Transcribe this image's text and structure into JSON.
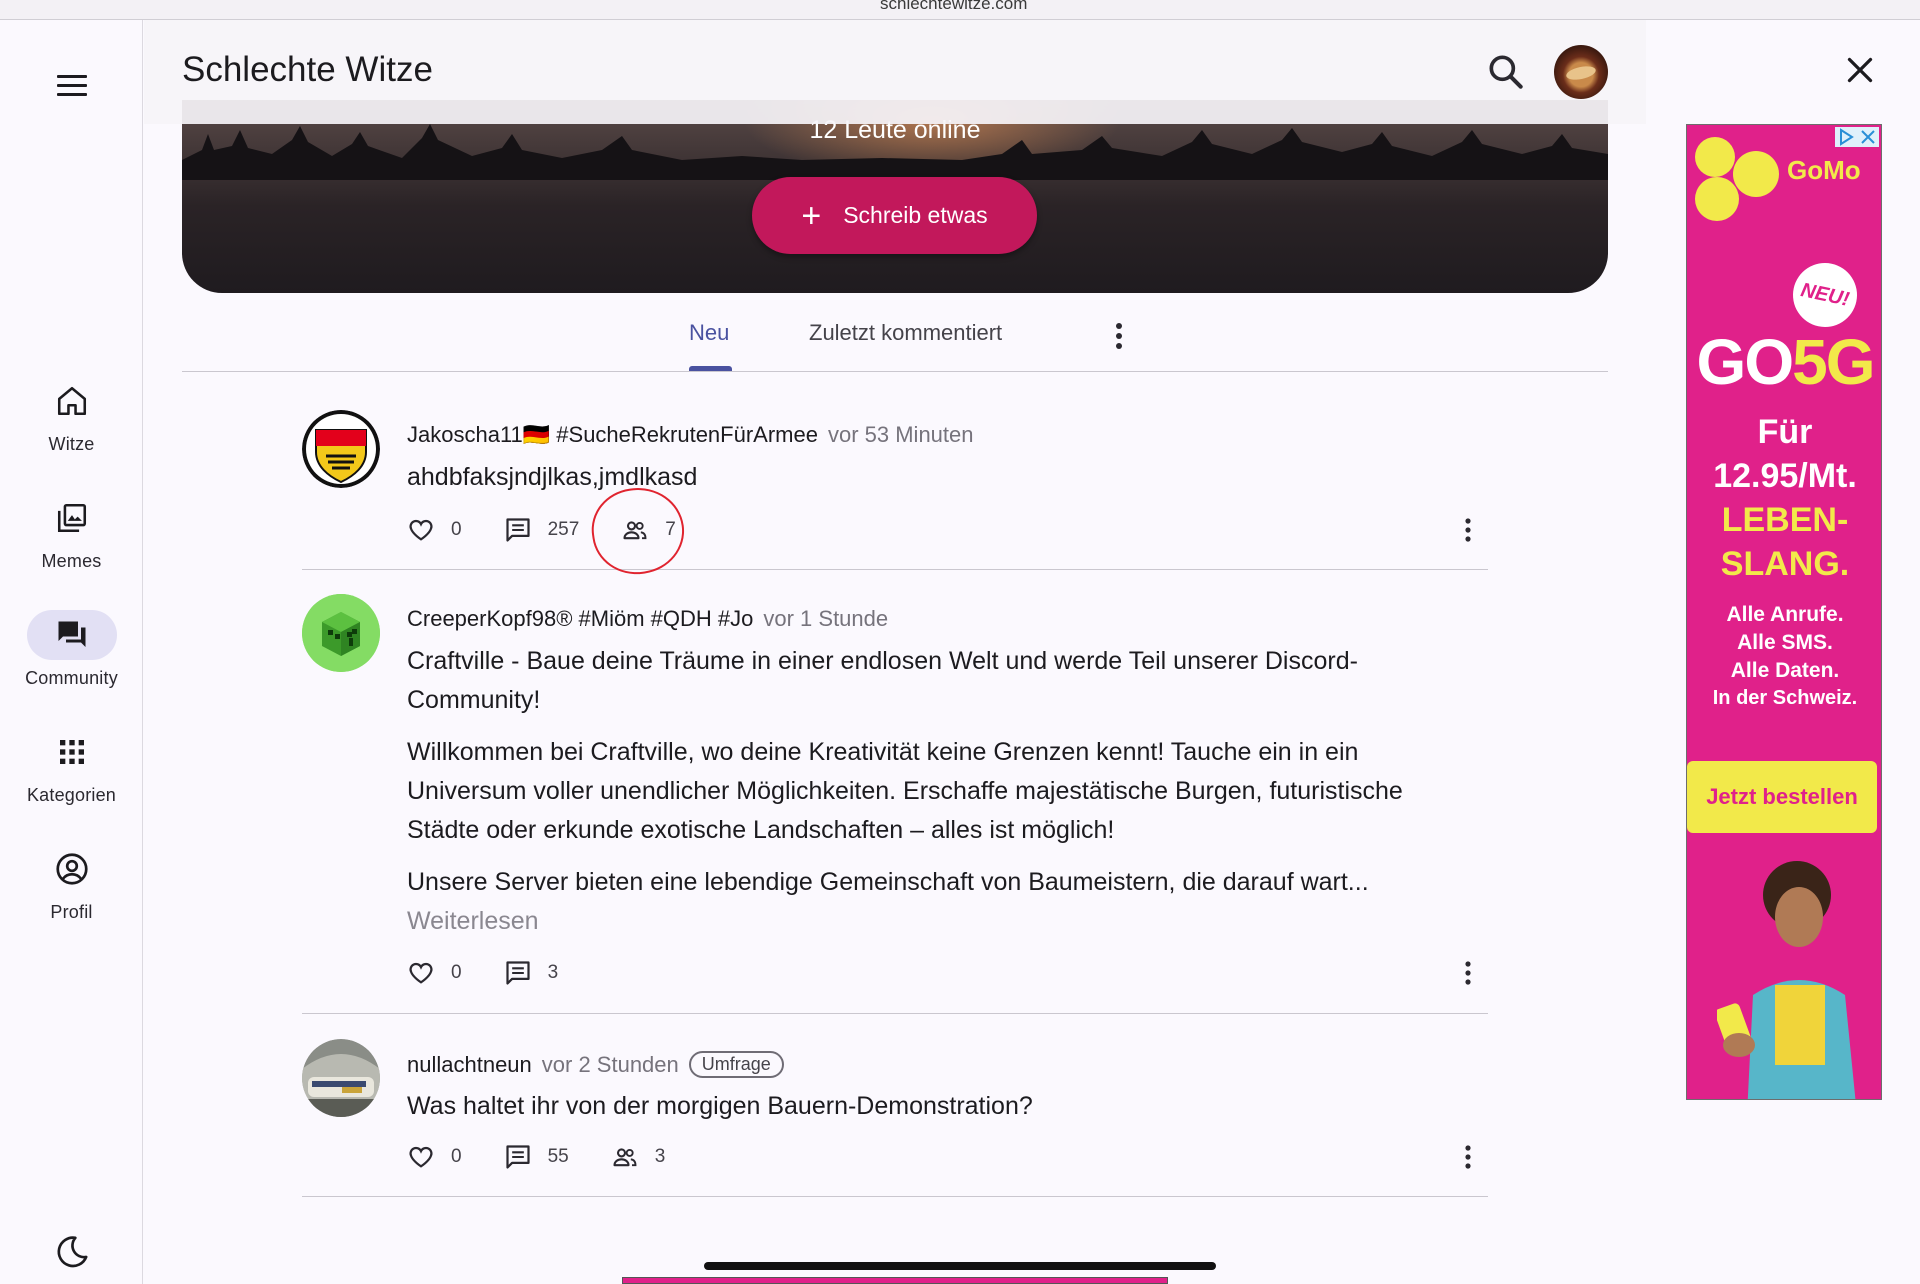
{
  "browser": {
    "url_fragment": "schlechtewitze.com"
  },
  "sidebar": {
    "items": [
      {
        "label": "Witze",
        "icon": "home-icon"
      },
      {
        "label": "Memes",
        "icon": "image-gallery-icon"
      },
      {
        "label": "Community",
        "icon": "forum-icon",
        "active": true
      },
      {
        "label": "Kategorien",
        "icon": "apps-grid-icon"
      },
      {
        "label": "Profil",
        "icon": "account-circle-icon"
      }
    ],
    "dark_mode_icon": "moon-icon"
  },
  "header": {
    "title": "Schlechte Witze",
    "search_icon": "search-icon",
    "avatar": "user-avatar"
  },
  "hero": {
    "online_text": "12 Leute online",
    "write_button": "Schreib etwas"
  },
  "tabs": {
    "items": [
      "Neu",
      "Zuletzt kommentiert"
    ],
    "active": "Neu"
  },
  "posts": [
    {
      "author": "Jakoscha11🇩🇪 #SucheRekrutenFürArmee",
      "time": "vor 53 Minuten",
      "text": "ahdbfaksjndjlkas,jmdlkasd",
      "likes": "0",
      "comments": "257",
      "participants": "7"
    },
    {
      "author": "CreeperKopf98® #Miöm #QDH #Jo",
      "time": "vor 1 Stunde",
      "paragraphs": [
        "Craftville - Baue deine Träume in einer endlosen Welt und werde Teil unserer Discord-Community!",
        "Willkommen bei Craftville, wo deine Kreativität keine Grenzen kennt! Tauche ein in ein Universum voller unendlicher Möglichkeiten. Erschaffe majestätische Burgen, futuristische Städte oder erkunde exotische Landschaften – alles ist möglich!",
        "Unsere Server bieten eine lebendige Gemeinschaft von Baumeistern, die darauf wart..."
      ],
      "read_more": "Weiterlesen",
      "likes": "0",
      "comments": "3"
    },
    {
      "author": "nullachtneun",
      "time": "vor 2 Stunden",
      "badge": "Umfrage",
      "text": "Was haltet ihr von der morgigen Bauern-Demonstration?",
      "likes": "0",
      "comments": "55",
      "participants": "3"
    }
  ],
  "ad": {
    "brand": "GoMo",
    "new_badge": "NEU!",
    "headline_go": "GO",
    "headline_5g": "5G",
    "price_line1": "Für",
    "price_line2": "12.95/Mt.",
    "slogan_line1": "LEBEN-",
    "slogan_line2": "SLANG.",
    "features": [
      "Alle Anrufe.",
      "Alle SMS.",
      "Alle Daten.",
      "In der Schweiz."
    ],
    "cta": "Jetzt bestellen",
    "colors": {
      "background": "#e0218a",
      "accent": "#f2e94a"
    }
  },
  "colors": {
    "primary_button": "#c2185b",
    "tab_active": "#4a52a0",
    "annotation_circle": "#e0242f"
  }
}
